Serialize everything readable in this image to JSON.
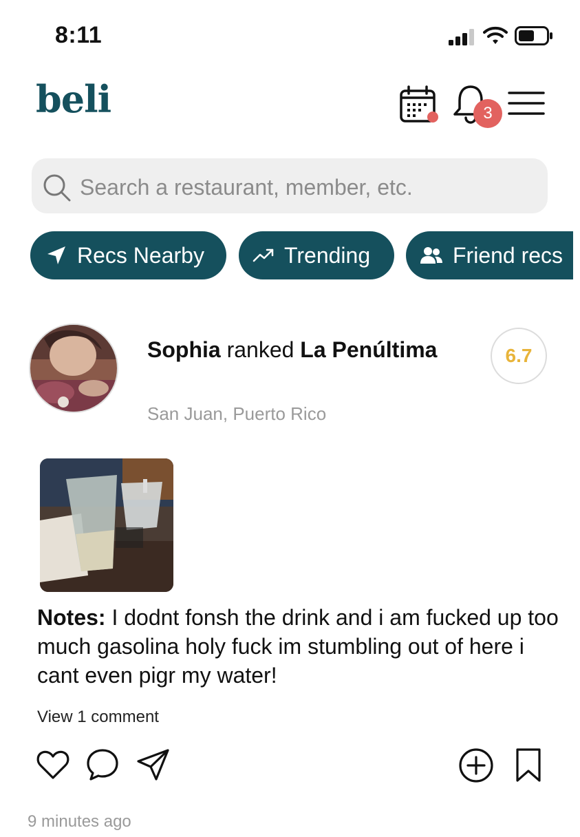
{
  "status_bar": {
    "time": "8:11"
  },
  "header": {
    "logo": "beli",
    "notification_count": "3"
  },
  "search": {
    "placeholder": "Search a restaurant, member, etc."
  },
  "chips": {
    "nearby": {
      "label": "Recs Nearby",
      "icon": "location-arrow-icon"
    },
    "trending": {
      "label": "Trending",
      "icon": "trending-up-icon"
    },
    "friends": {
      "label": "Friend recs",
      "icon": "people-icon"
    }
  },
  "post": {
    "user": "Sophia",
    "action": "ranked",
    "restaurant": "La Penúltima",
    "location": "San Juan, Puerto Rico",
    "score": "6.7",
    "notes_label": "Notes:",
    "notes_text": "I dodnt fonsh the drink and i am fucked up too much gasolina holy fuck im stumbling out of here i cant even pigr my water!",
    "view_comments": "View 1 comment",
    "timestamp": "9 minutes ago"
  },
  "colors": {
    "brand": "#15505d",
    "badge": "#e2625f",
    "score": "#e8b43a"
  }
}
